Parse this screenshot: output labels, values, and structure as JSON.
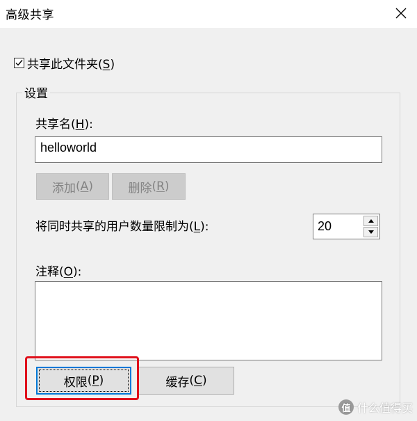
{
  "window": {
    "title": "高级共享",
    "close_icon": "close-icon"
  },
  "share_checkbox": {
    "label": "共享此文件夹",
    "hotkey": "S",
    "checked": true
  },
  "settings_group": {
    "legend": "设置",
    "share_name": {
      "label": "共享名",
      "hotkey": "H",
      "suffix": ":",
      "value": "helloworld"
    },
    "add_button": {
      "label": "添加",
      "hotkey": "A",
      "enabled": false
    },
    "remove_button": {
      "label": "删除",
      "hotkey": "R",
      "enabled": false
    },
    "user_limit": {
      "label": "将同时共享的用户数量限制为",
      "hotkey": "L",
      "suffix": ":",
      "value": "20"
    },
    "comment": {
      "label": "注释",
      "hotkey": "O",
      "suffix": ":",
      "value": ""
    }
  },
  "buttons": {
    "permissions": {
      "label": "权限",
      "hotkey": "P"
    },
    "caching": {
      "label": "缓存",
      "hotkey": "C"
    }
  },
  "annotation": {
    "highlight_color": "#e0111c"
  },
  "watermark": {
    "text": "什么值得买",
    "logo_char": "值"
  }
}
